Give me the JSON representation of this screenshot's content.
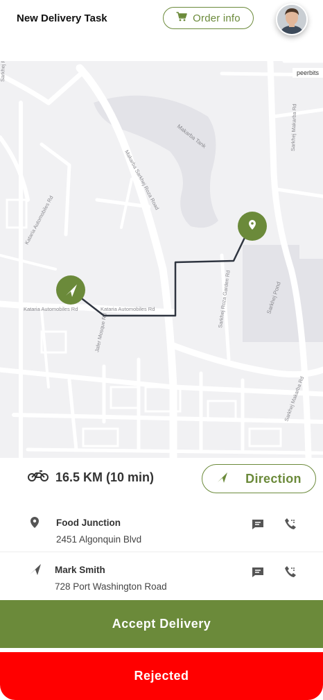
{
  "header": {
    "title": "New Delivery Task",
    "order_info_label": "Order info",
    "avatar_icon": "user-avatar"
  },
  "map": {
    "attribution": "peerbits",
    "labels": {
      "road_1": "Kataria Automobiles Rd",
      "road_2": "Kataria Automobiles Rd",
      "road_3": "Kataria Automobiles Rd",
      "road_4": "Makarba Sarkhej Roza Road",
      "road_5": "Sarkhej Roza Garden Rd",
      "road_6": "Sarkhej Makarba Rd",
      "road_7": "Sarkhej Makarba Rd",
      "road_8": "Jafer Mosque Rd",
      "lake_1": "Makarba Tank",
      "lake_2": "Sarkhej Pond",
      "road_9": "Sarkhej Rd"
    },
    "route_color": "#2f3540",
    "marker_color": "#6b8a3a"
  },
  "trip": {
    "distance_text": "16.5 KM (10 min)",
    "direction_label": "Direction"
  },
  "pickup": {
    "name": "Food Junction",
    "address": "2451  Algonquin Blvd",
    "icons": [
      "location-pin-icon",
      "message-icon",
      "phone-icon"
    ]
  },
  "dropoff": {
    "name": "Mark Smith",
    "address": "728  Port Washington Road",
    "icons": [
      "navigation-arrow-icon",
      "message-icon",
      "phone-icon"
    ]
  },
  "actions": {
    "accept_label": "Accept Delivery",
    "reject_label": "Rejected"
  },
  "colors": {
    "accent": "#6b8a3a",
    "reject": "#ff0000"
  }
}
